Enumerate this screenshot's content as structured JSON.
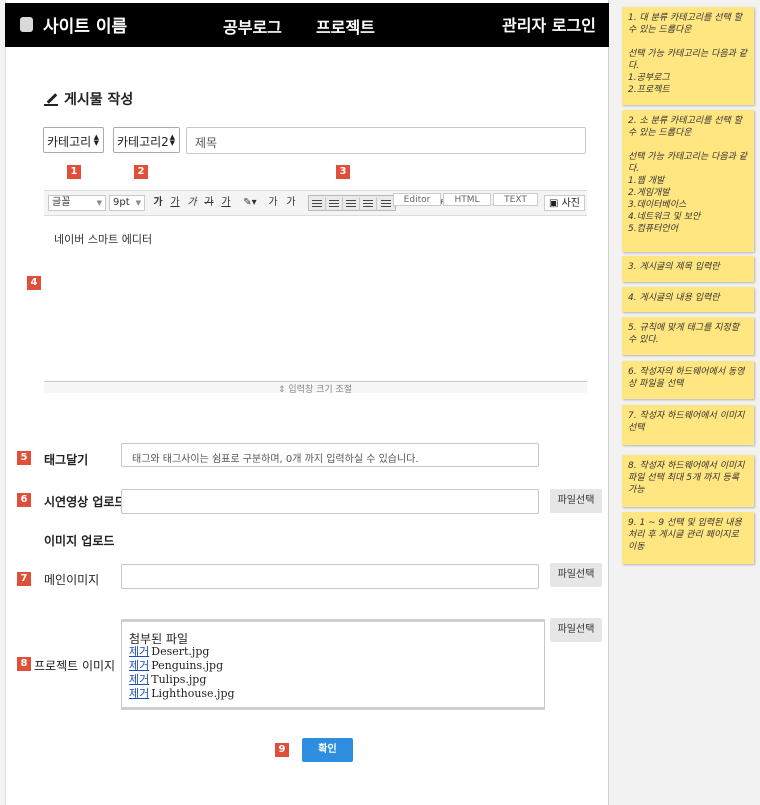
{
  "header": {
    "site_name": "사이트 이름",
    "nav": [
      "공부로그",
      "프로젝트"
    ],
    "admin_login": "관리자 로그인"
  },
  "page_title": "게시물 작성",
  "category1": "카테고리",
  "category2": "카테고리2",
  "title_placeholder": "제목",
  "editor": {
    "font": "글꼴",
    "size": "9pt",
    "buttons": [
      "가",
      "가",
      "가",
      "가",
      "가",
      "가",
      "가",
      "가"
    ],
    "photo": "사진",
    "content": "네이버 스마트 에디터",
    "resize": "⇕ 입력창 크기 조절",
    "modes": [
      "Editor",
      "HTML",
      "TEXT"
    ]
  },
  "tags": {
    "label": "태그달기",
    "placeholder": "태그와 태그사이는 쉼표로 구분하며, 0개 까지 입력하실 수 있습니다."
  },
  "video": {
    "label": "시연영상 업로드",
    "button": "파일선택"
  },
  "image_section": "이미지 업로드",
  "main_image": {
    "label": "메인이미지",
    "button": "파일선택"
  },
  "project_images": {
    "label": "프로젝트 이미지",
    "button": "파일선택",
    "attach_title": "첨부된 파일",
    "remove_label": "제거",
    "files": [
      "Desert.jpg",
      "Penguins.jpg",
      "Tulips.jpg",
      "Lighthouse.jpg"
    ]
  },
  "confirm": "확인",
  "markers": [
    "1",
    "2",
    "3",
    "4",
    "5",
    "6",
    "7",
    "8",
    "9"
  ],
  "notes": [
    "1. 대 분류 카테고리를 선택 할 수 있는 드롭다운\n\n선택 가능 카테고리는 다음과 같다.\n1.공부로그\n2.프로젝트",
    "2. 소 분류 카테고리를 선택 할 수 있는 드롭다운\n\n선택 가능 카테고리는 다음과 같다.\n1.웹 개발\n2.게임개발\n3.데이터베이스\n4.네트워크 및 보안\n5.컴퓨터언어",
    "3. 게시글의 제목 입력란",
    "4. 게시글의 내용 입력란",
    "5. 규칙에 맞게 태그를 지정할 수 있다.",
    "6. 작성자의 하드웨어에서 동영상 파일을 선택",
    "7. 작성자 하드웨어에서 이미지 선택",
    "8. 작성자 하드웨어에서 이미지 파일 선택 최대 5개 까지 등록 가능",
    "9. 1 ~ 9 선택 및 입력된 내용 처리 후 게시글 관리 페이지로 이동"
  ],
  "colors": {
    "header_bg": "#000000",
    "marker": "#e04f3a",
    "confirm": "#2d8ee0",
    "note": "#ffe680"
  }
}
